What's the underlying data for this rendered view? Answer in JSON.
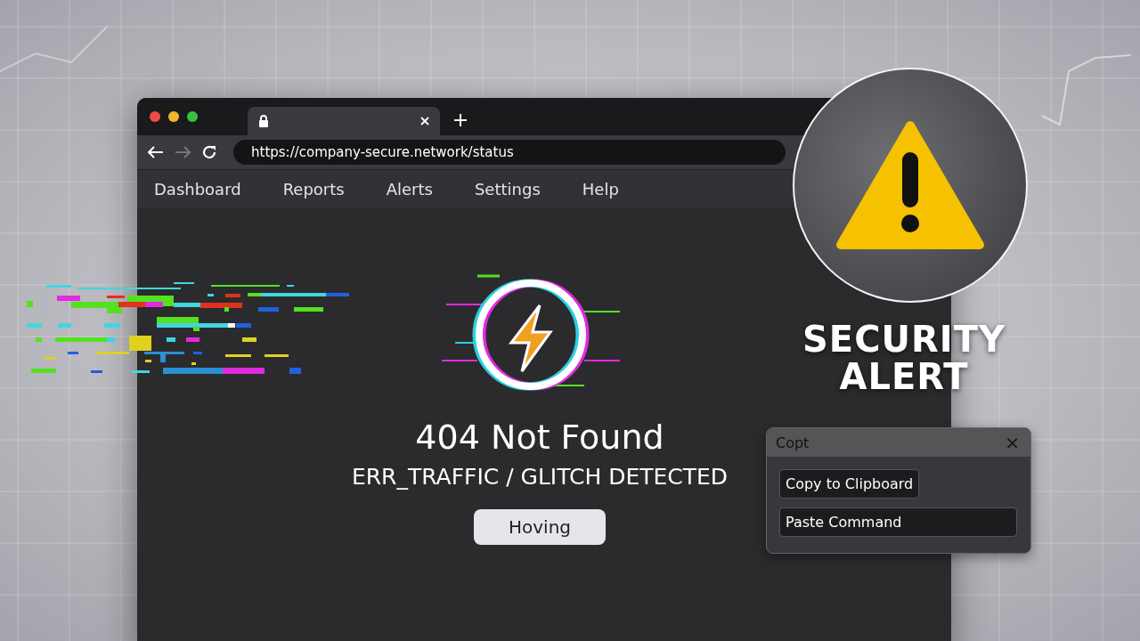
{
  "browser": {
    "url": "https://company-secure.network/status",
    "nav": [
      {
        "label": "Dashboard"
      },
      {
        "label": "Reports"
      },
      {
        "label": "Alerts"
      },
      {
        "label": "Settings"
      },
      {
        "label": "Help"
      }
    ]
  },
  "error": {
    "title": "404 Not Found",
    "message": "ERR_TRAFFIC / GLITCH DETECTED",
    "button": "Hoving"
  },
  "alert": {
    "title": "SECURITY ALERT"
  },
  "popup": {
    "title": "Copt",
    "close": "×",
    "actions": [
      "Copy to Clipboard",
      "Paste Command"
    ]
  }
}
